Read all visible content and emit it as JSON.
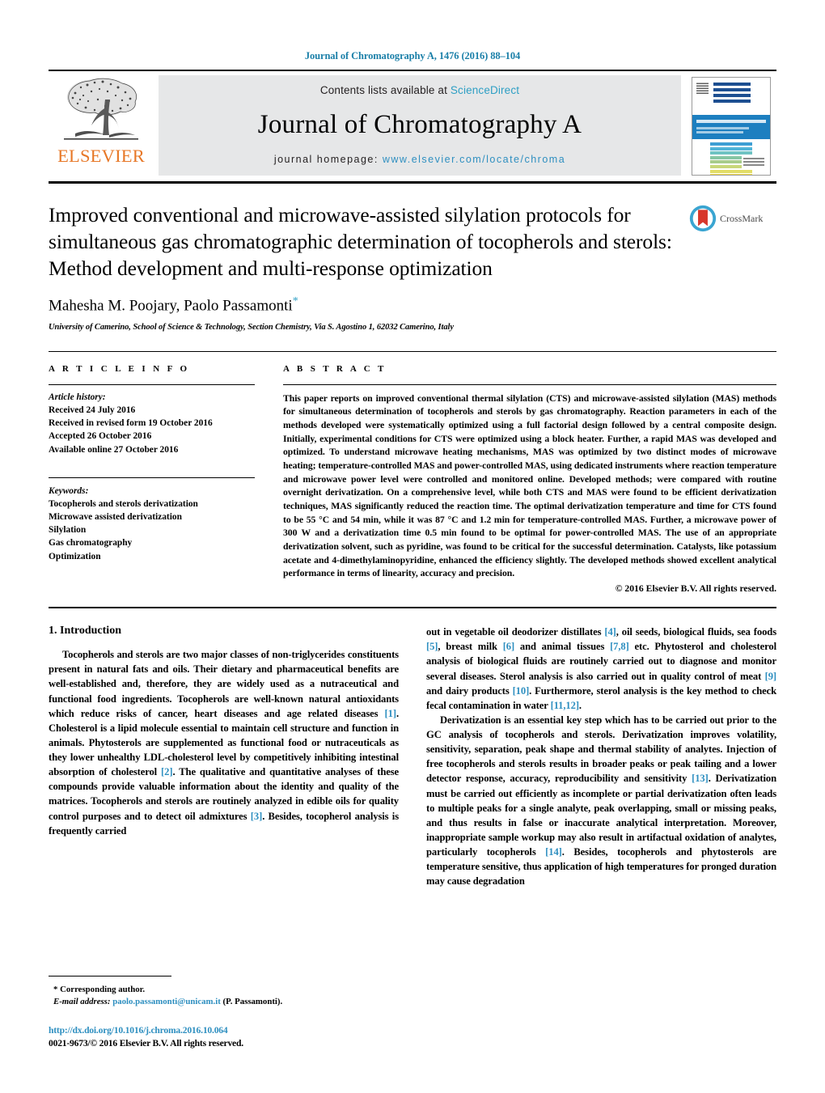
{
  "running_head": "Journal of Chromatography A, 1476 (2016) 88–104",
  "masthead": {
    "publisher_name": "ELSEVIER",
    "contents_prefix": "Contents lists available at ",
    "contents_link": "ScienceDirect",
    "journal_title": "Journal of Chromatography A",
    "homepage_prefix": "journal homepage: ",
    "homepage_url": "www.elsevier.com/locate/chroma"
  },
  "crossmark": {
    "label": "CrossMark"
  },
  "article": {
    "title": "Improved conventional and microwave-assisted silylation protocols for simultaneous gas chromatographic determination of tocopherols and sterols: Method development and multi-response optimization",
    "authors": "Mahesha M. Poojary, Paolo Passamonti",
    "corresponding_marker": "*",
    "affiliation": "University of Camerino, School of Science & Technology, Section Chemistry, Via S. Agostino 1, 62032 Camerino, Italy"
  },
  "article_info": {
    "label": "A R T I C L E    I N F O",
    "history_label": "Article history:",
    "history": [
      "Received 24 July 2016",
      "Received in revised form 19 October 2016",
      "Accepted 26 October 2016",
      "Available online 27 October 2016"
    ],
    "keywords_label": "Keywords:",
    "keywords": [
      "Tocopherols and sterols derivatization",
      "Microwave assisted derivatization",
      "Silylation",
      "Gas chromatography",
      "Optimization"
    ]
  },
  "abstract": {
    "label": "A B S T R A C T",
    "text": "This paper reports on improved conventional thermal silylation (CTS) and microwave-assisted silylation (MAS) methods for simultaneous determination of tocopherols and sterols by gas chromatography. Reaction parameters in each of the methods developed were systematically optimized using a full factorial design followed by a central composite design. Initially, experimental conditions for CTS were optimized using a block heater. Further, a rapid MAS was developed and optimized. To understand microwave heating mechanisms, MAS was optimized by two distinct modes of microwave heating; temperature-controlled MAS and power-controlled MAS, using dedicated instruments where reaction temperature and microwave power level were controlled and monitored online. Developed methods; were compared with routine overnight derivatization. On a comprehensive level, while both CTS and MAS were found to be efficient derivatization techniques, MAS significantly reduced the reaction time. The optimal derivatization temperature and time for CTS found to be 55 °C and 54 min, while it was 87 °C and 1.2 min for temperature-controlled MAS. Further, a microwave power of 300 W and a derivatization time 0.5 min found to be optimal for power-controlled MAS. The use of an appropriate derivatization solvent, such as pyridine, was found to be critical for the successful determination. Catalysts, like potassium acetate and 4-dimethylaminopyridine, enhanced the efficiency slightly. The developed methods showed excellent analytical performance in terms of linearity, accuracy and precision.",
    "copyright": "© 2016 Elsevier B.V. All rights reserved."
  },
  "introduction": {
    "heading": "1.  Introduction",
    "left_para_1_a": "Tocopherols and sterols are two major classes of non-triglycerides constituents present in natural fats and oils. Their dietary and pharmaceutical benefits are well-established and, therefore, they are widely used as a nutraceutical and functional food ingredients. Tocopherols are well-known natural antioxidants which reduce risks of cancer, heart diseases and age related diseases ",
    "left_ref_1": "[1]",
    "left_para_1_b": ". Cholesterol is a lipid molecule essential to maintain cell structure and function in animals. Phytosterols are supplemented as functional food or nutraceuticals as they lower unhealthy LDL-cholesterol level by competitively inhibiting intestinal absorption of cholesterol ",
    "left_ref_2": "[2]",
    "left_para_1_c": ". The qualitative and quantitative analyses of these compounds provide valuable information about the identity and quality of the matrices. Tocopherols and sterols are routinely analyzed in edible oils for quality control purposes and to detect oil admixtures ",
    "left_ref_3": "[3]",
    "left_para_1_d": ". Besides, tocopherol analysis is frequently carried",
    "right_cont_a": "out in vegetable oil deodorizer distillates ",
    "right_ref_4": "[4]",
    "right_cont_b": ", oil seeds, biological fluids, sea foods ",
    "right_ref_5": "[5]",
    "right_cont_c": ", breast milk ",
    "right_ref_6": "[6]",
    "right_cont_d": " and animal tissues ",
    "right_ref_78": "[7,8]",
    "right_cont_e": " etc. Phytosterol and cholesterol analysis of biological fluids are routinely carried out to diagnose and monitor several diseases. Sterol analysis is also carried out in quality control of meat ",
    "right_ref_9": "[9]",
    "right_cont_f": " and dairy products ",
    "right_ref_10": "[10]",
    "right_cont_g": ". Furthermore, sterol analysis is the key method to check fecal contamination in water ",
    "right_ref_1112": "[11,12]",
    "right_cont_h": ".",
    "right_para2_a": "Derivatization is an essential key step which has to be carried out prior to the GC analysis of tocopherols and sterols. Derivatization improves volatility, sensitivity, separation, peak shape and thermal stability of analytes. Injection of free tocopherols and sterols results in broader peaks or peak tailing and a lower detector response, accuracy, reproducibility and sensitivity ",
    "right_ref_13": "[13]",
    "right_para2_b": ". Derivatization must be carried out efficiently as incomplete or partial derivatization often leads to multiple peaks for a single analyte, peak overlapping, small or missing peaks, and thus results in false or inaccurate analytical interpretation. Moreover, inappropriate sample workup may also result in artifactual oxidation of analytes, particularly tocopherols ",
    "right_ref_14": "[14]",
    "right_para2_c": ". Besides, tocopherols and phytosterols are temperature sensitive, thus application of high temperatures for pronged duration may cause degradation"
  },
  "footnote": {
    "corresponding": "*  Corresponding author.",
    "email_label": "E-mail address:",
    "email": "paolo.passamonti@unicam.it",
    "email_suffix": " (P. Passamonti).",
    "doi": "http://dx.doi.org/10.1016/j.chroma.2016.10.064",
    "issn": "0021-9673/© 2016 Elsevier B.V. All rights reserved."
  },
  "colors": {
    "link": "#2e8fc0",
    "running_head": "#1a7fa8",
    "elsevier_orange": "#E77726",
    "masthead_bg": "#e6e7e8"
  },
  "cover_stripes": [
    "#1d4f91",
    "#1d4f91",
    "#1d4f91",
    "#1d4f91",
    "#3e9ed4",
    "#51b4d8",
    "#6fc3c3",
    "#86c6a4",
    "#a8cc8c",
    "#c9d77a",
    "#e2dd66",
    "#f2d93f",
    "#f6c92c",
    "#f3b526",
    "#efa225",
    "#eb8f24",
    "#e87b27",
    "#e3672b",
    "#e0552e"
  ]
}
